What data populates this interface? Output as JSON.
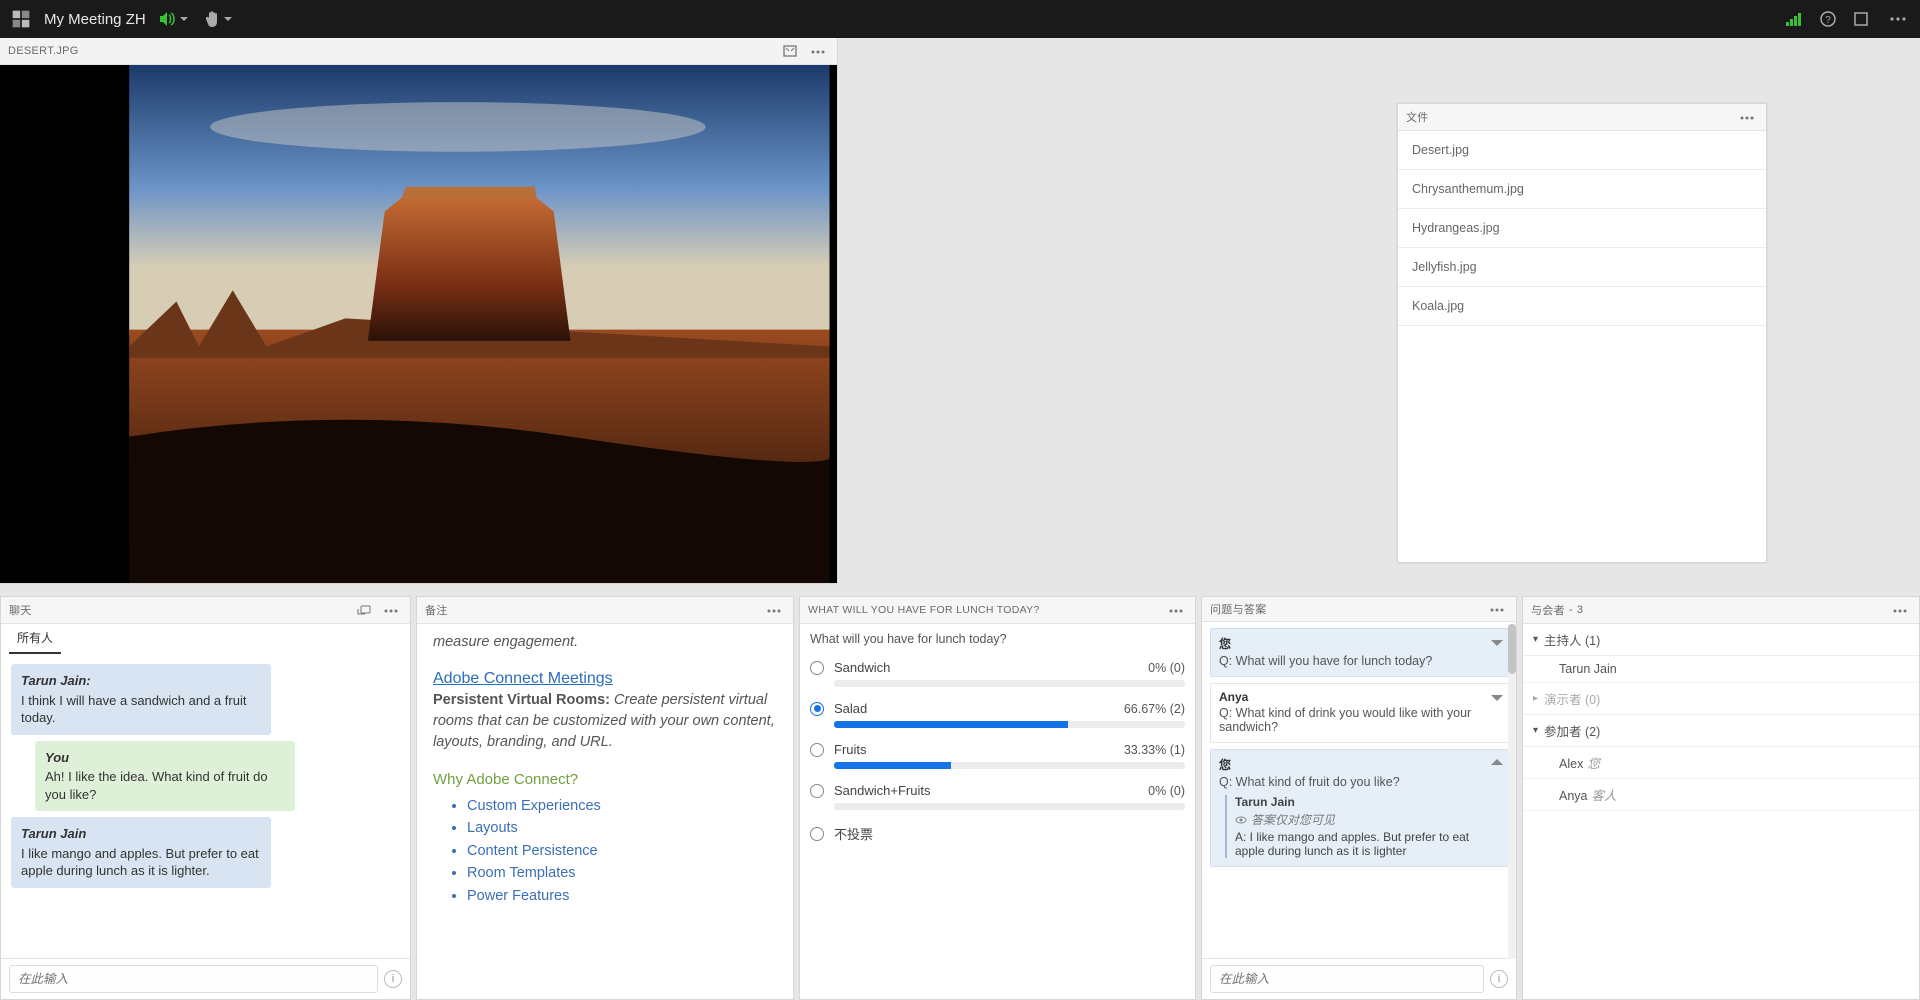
{
  "app": {
    "title": "My Meeting ZH"
  },
  "share": {
    "filename": "DESERT.JPG"
  },
  "files": {
    "title": "文件",
    "items": [
      "Desert.jpg",
      "Chrysanthemum.jpg",
      "Hydrangeas.jpg",
      "Jellyfish.jpg",
      "Koala.jpg"
    ]
  },
  "chat": {
    "title": "聊天",
    "tab": "所有人",
    "input_ph": "在此输入",
    "messages": [
      {
        "who": "Tarun Jain:",
        "text": "I think I will have a sandwich and a fruit today.",
        "cls": "blue"
      },
      {
        "who": "You",
        "text": "Ah! I like the idea. What kind of fruit do you like?",
        "cls": "grn"
      },
      {
        "who": "Tarun Jain",
        "text": "I like mango and apples. But prefer to eat apple during lunch as it is lighter.",
        "cls": "blue"
      }
    ]
  },
  "notes": {
    "title": "备注",
    "lead_italic": "measure engagement.",
    "link": "Adobe Connect Meetings",
    "strong": "Persistent Virtual Rooms:",
    "rest": "Create persistent virtual rooms that can be customized with your own content, layouts, branding, and URL.",
    "why": "Why Adobe Connect?",
    "bullets": [
      "Custom Experiences",
      "Layouts",
      "Content Persistence",
      "Room Templates",
      "Power Features"
    ]
  },
  "poll": {
    "title": "WHAT WILL YOU HAVE FOR LUNCH TODAY?",
    "question": "What will you have for lunch today?",
    "options": [
      {
        "label": "Sandwich",
        "pct": "0% (0)",
        "bar": 0,
        "sel": false,
        "hasbar": true
      },
      {
        "label": "Salad",
        "pct": "66.67% (2)",
        "bar": 66.67,
        "sel": true,
        "hasbar": true
      },
      {
        "label": "Fruits",
        "pct": "33.33% (1)",
        "bar": 33.33,
        "sel": false,
        "hasbar": true
      },
      {
        "label": "Sandwich+Fruits",
        "pct": "0% (0)",
        "bar": 0,
        "sel": false,
        "hasbar": true
      },
      {
        "label": "不投票",
        "pct": "",
        "bar": 0,
        "sel": false,
        "hasbar": false
      }
    ]
  },
  "qna": {
    "title": "问题与答案",
    "input_ph": "在此输入",
    "items": [
      {
        "mine": true,
        "name": "您",
        "q": "Q: What will you have for lunch today?",
        "open": false
      },
      {
        "mine": false,
        "name": "Anya",
        "q": "Q: What kind of drink you would like with your sandwich?",
        "open": false
      },
      {
        "mine": true,
        "name": "您",
        "q": "Q: What kind of fruit do you like?",
        "open": true,
        "answer": {
          "name": "Tarun Jain",
          "vis": "答案仅对您可见",
          "text": "A: I like mango and apples. But prefer to eat apple during lunch as it is lighter"
        }
      }
    ]
  },
  "att": {
    "title": "与会者",
    "count": "3",
    "groups": {
      "host": {
        "label": "主持人 (1)",
        "people": [
          {
            "name": "Tarun Jain",
            "role": ""
          }
        ],
        "open": true
      },
      "presenter": {
        "label": "演示者 (0)",
        "people": [],
        "open": false
      },
      "participant": {
        "label": "参加者 (2)",
        "people": [
          {
            "name": "Alex",
            "role": "您"
          },
          {
            "name": "Anya",
            "role": "客人"
          }
        ],
        "open": true
      }
    }
  }
}
